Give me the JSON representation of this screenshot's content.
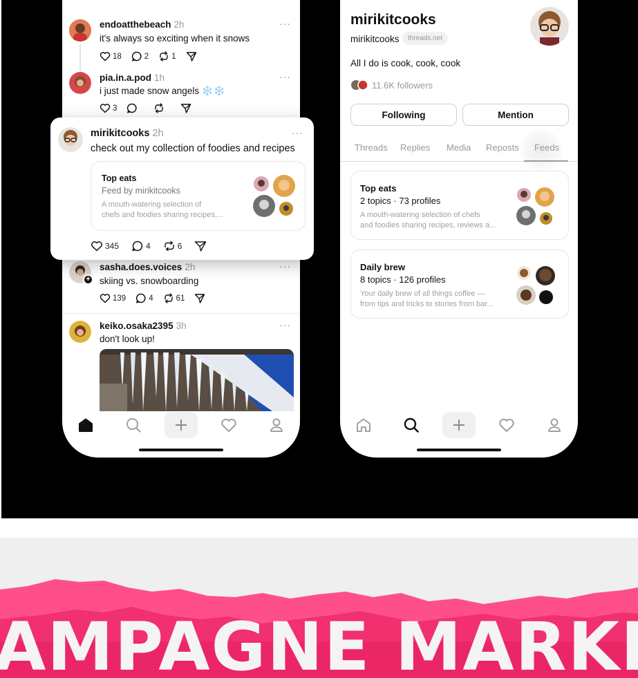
{
  "feed": {
    "posts": [
      {
        "user": "endoatthebeach",
        "time": "2h",
        "text": "it's always so exciting when it snows",
        "likes": "18",
        "replies": "2",
        "reposts": "1"
      },
      {
        "user": "pia.in.a.pod",
        "time": "1h",
        "text": "i just made snow angels ❄️❄️",
        "likes": "3",
        "replies": "",
        "reposts": ""
      },
      {
        "user": "sasha.does.voices",
        "time": "2h",
        "text": "skiing vs. snowboarding",
        "likes": "139",
        "replies": "4",
        "reposts": "61"
      },
      {
        "user": "keiko.osaka2395",
        "time": "3h",
        "text": "don't look up!"
      }
    ],
    "highlight": {
      "user": "mirikitcooks",
      "time": "2h",
      "text": "check out my collection of foodies and recipes",
      "feed_title": "Top eats",
      "feed_by": "Feed by mirikitcooks",
      "feed_desc_1": "A mouth-watering selection of",
      "feed_desc_2": "chefs and foodies sharing recipes,...",
      "likes": "345",
      "replies": "4",
      "reposts": "6"
    }
  },
  "profile": {
    "name": "mirikitcooks",
    "handle": "mirikitcooks",
    "domain_badge": "threads.net",
    "bio": "All I do is cook, cook, cook",
    "followers": "11.6K followers",
    "following_button": "Following",
    "mention_button": "Mention",
    "tabs": [
      "Threads",
      "Replies",
      "Media",
      "Reposts",
      "Feeds"
    ],
    "active_tab": "Feeds",
    "feeds": [
      {
        "title": "Top eats",
        "stats": "2 topics · 73 profiles",
        "desc_1": "A mouth-watering selection of chefs",
        "desc_2": "and foodies sharing recipes, reviews a..."
      },
      {
        "title": "Daily brew",
        "stats": "8 topics · 126 profiles",
        "desc_1": "Your daily brew of all things coffee —",
        "desc_2": "from tips and tricks to stories from bar..."
      }
    ]
  },
  "nav_icons": [
    "home-icon",
    "search-icon",
    "plus-icon",
    "heart-icon",
    "profile-icon"
  ],
  "banner": {
    "text": "AMPAGNE MARKETIN"
  },
  "colors": {
    "stage": "#000000",
    "banner_pink": "#ff3d7f",
    "banner_bg": "#efefef",
    "text_muted": "#9a9a9a"
  }
}
